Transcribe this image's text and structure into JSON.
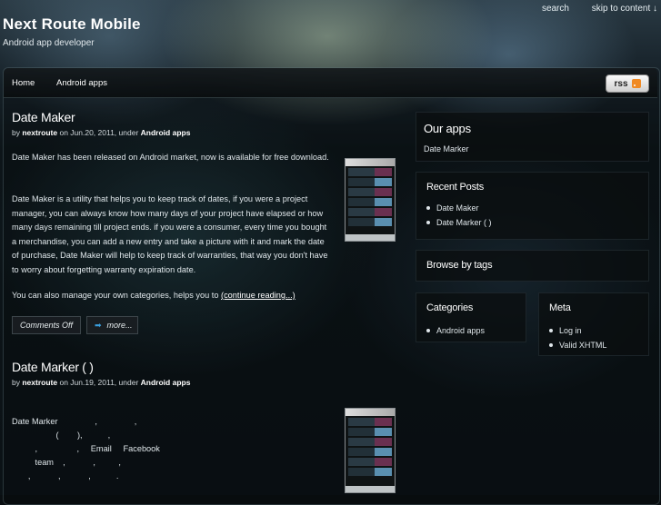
{
  "top_links": [
    "search",
    "skip to content ↓"
  ],
  "site": {
    "title": "Next Route Mobile",
    "description": "Android app developer"
  },
  "nav": {
    "items": [
      "Home",
      "Android apps"
    ],
    "rss_label": "rss"
  },
  "posts": [
    {
      "title": "Date Maker",
      "meta_by": "by",
      "author": "nextroute",
      "meta_on": "on Jun.20, 2011, under",
      "category": "Android apps",
      "p1": "Date Maker has been released on Android market, now is available for free download.",
      "p2": "Date Maker is a utility that helps you to keep track of dates,  if you were a project manager, you can always know how many days of your project have elapsed or how many days remaining till project ends. if you were a consumer, every time you bought a merchandise, you can add a new entry and take a picture with it and mark the date of purchase, Date Maker will help to keep track of warranties, that way you don't have to worry about forgetting warranty expiration date.",
      "p3": "You can also manage your own categories, helps you to",
      "continue": "(continue reading...)",
      "comments": "Comments Off",
      "more": "more..."
    },
    {
      "title": "Date Marker (   )",
      "meta_by": "by",
      "author": "nextroute",
      "meta_on": "on Jun.19, 2011, under",
      "category": "Android apps",
      "lines": [
        "Date Marker                ,                ,",
        "                   (        ),           ,",
        "          ,                 ,     Email     Facebook",
        "          team    ,            ,          ,",
        "       ,            ,            ,           ."
      ]
    }
  ],
  "sidebar": {
    "our_apps": {
      "title": "Our apps",
      "text": "Date Marker"
    },
    "recent_posts": {
      "title": "Recent Posts",
      "items": [
        "Date Maker",
        "Date Marker (    )"
      ]
    },
    "browse": {
      "title": "Browse by tags"
    },
    "categories": {
      "title": "Categories",
      "items": [
        "Android apps"
      ]
    },
    "meta": {
      "title": "Meta",
      "items": [
        "Log in",
        "Valid XHTML"
      ]
    }
  },
  "icons": {
    "rss": "rss-feed-icon",
    "more": "arrow-right-icon"
  }
}
